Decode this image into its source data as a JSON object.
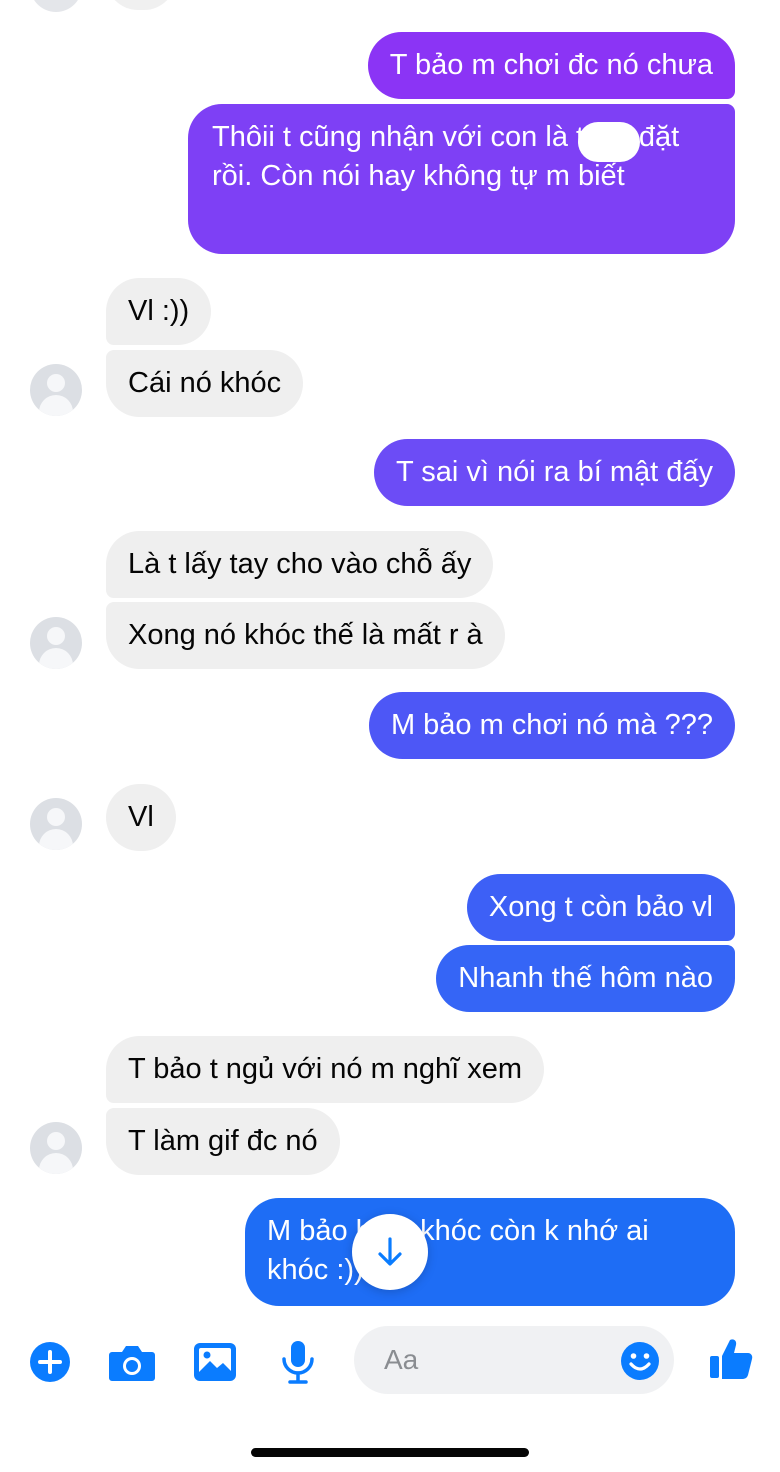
{
  "colors": {
    "accent": "#0a7cff",
    "incoming_bubble": "#efefef",
    "gradient_purple": "#8b33f5",
    "gradient_blue": "#1a6ff5"
  },
  "messages": [
    {
      "side": "out",
      "text": "T bảo m chơi đc nó chưa"
    },
    {
      "side": "out",
      "text": "Thôii t cũng nhận với con      là t bịa đặt rồi. Còn nói hay không tự m biết"
    },
    {
      "side": "in",
      "text": "Vl :))"
    },
    {
      "side": "in",
      "text": "Cái nó khóc"
    },
    {
      "side": "out",
      "text": "T sai vì nói ra bí mật đấy"
    },
    {
      "side": "in",
      "text": "Là t lấy tay cho vào chỗ ấy"
    },
    {
      "side": "in",
      "text": "Xong nó khóc thế là mất r à"
    },
    {
      "side": "out",
      "text": "M bảo m chơi nó mà ???"
    },
    {
      "side": "in",
      "text": "Vl"
    },
    {
      "side": "out",
      "text": "Xong t còn bảo vl"
    },
    {
      "side": "out",
      "text": "Nhanh thế hôm nào"
    },
    {
      "side": "in",
      "text": "T bảo t ngủ với nó m nghĩ xem"
    },
    {
      "side": "in",
      "text": "T làm gif đc nó"
    },
    {
      "side": "out",
      "text": "M bảo    hôm khóc còn k nhớ ai khóc :))"
    }
  ],
  "composer": {
    "placeholder": "Aa",
    "icons": [
      "plus-circle-icon",
      "camera-icon",
      "gallery-icon",
      "microphone-icon",
      "emoji-icon",
      "like-thumbs-up-icon"
    ]
  },
  "scroll_button_icon": "arrow-down-icon"
}
